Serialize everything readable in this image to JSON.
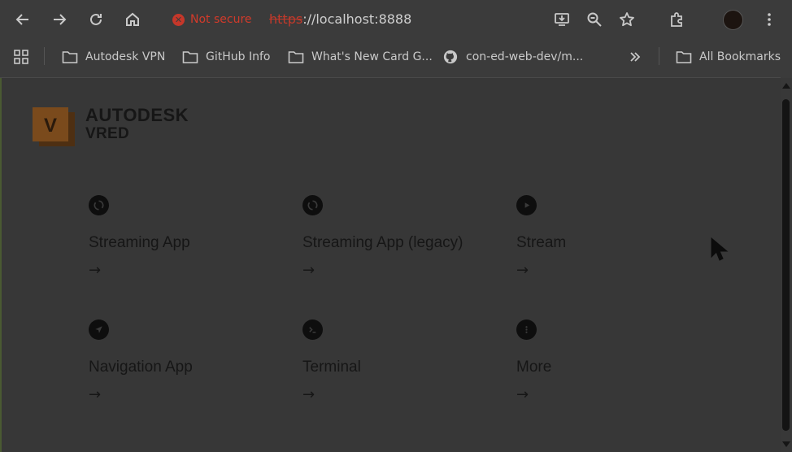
{
  "browser": {
    "security_label": "Not secure",
    "security_mark": "✕",
    "url_scheme": "https",
    "url_rest": "://localhost:8888",
    "nav_icons": [
      "back-arrow-icon",
      "forward-arrow-icon",
      "reload-icon",
      "home-icon"
    ],
    "toolbar_icons": [
      "install-app-icon",
      "zoom-icon",
      "star-bookmark-icon",
      "extensions-puzzle-icon",
      "profile-avatar",
      "kebab-menu-icon"
    ]
  },
  "bookmarks": {
    "apps_icon": "apps-grid-icon",
    "items": [
      {
        "label": "Autodesk VPN",
        "icon": "folder-icon"
      },
      {
        "label": "GitHub Info",
        "icon": "folder-icon"
      },
      {
        "label": "What's New Card G...",
        "icon": "folder-icon"
      },
      {
        "label": "con-ed-web-dev/m...",
        "icon": "github-icon"
      }
    ],
    "overflow_icon": "chevron-double-right-icon",
    "all_bookmarks": "All Bookmarks"
  },
  "logo": {
    "letter": "V",
    "brand": "AUTODESK",
    "product": "VRED",
    "colors": {
      "front": "#7a4a1c",
      "back": "#4e2f12",
      "letter": "#2a1a0c"
    }
  },
  "cards": [
    {
      "title": "Streaming App",
      "icon": "streaming-sync-icon",
      "arrow": "→"
    },
    {
      "title": "Streaming App (legacy)",
      "icon": "streaming-sync-icon",
      "arrow": "→"
    },
    {
      "title": "Stream",
      "icon": "play-icon",
      "arrow": "→"
    },
    {
      "title": "Navigation App",
      "icon": "navigation-arrow-icon",
      "arrow": "→"
    },
    {
      "title": "Terminal",
      "icon": "terminal-icon",
      "arrow": "→"
    },
    {
      "title": "More",
      "icon": "more-dots-icon",
      "arrow": "→"
    }
  ],
  "colors": {
    "chrome": "#3b3b3b",
    "page": "#373737",
    "text": "#161616",
    "not_secure": "#d23a2a"
  }
}
